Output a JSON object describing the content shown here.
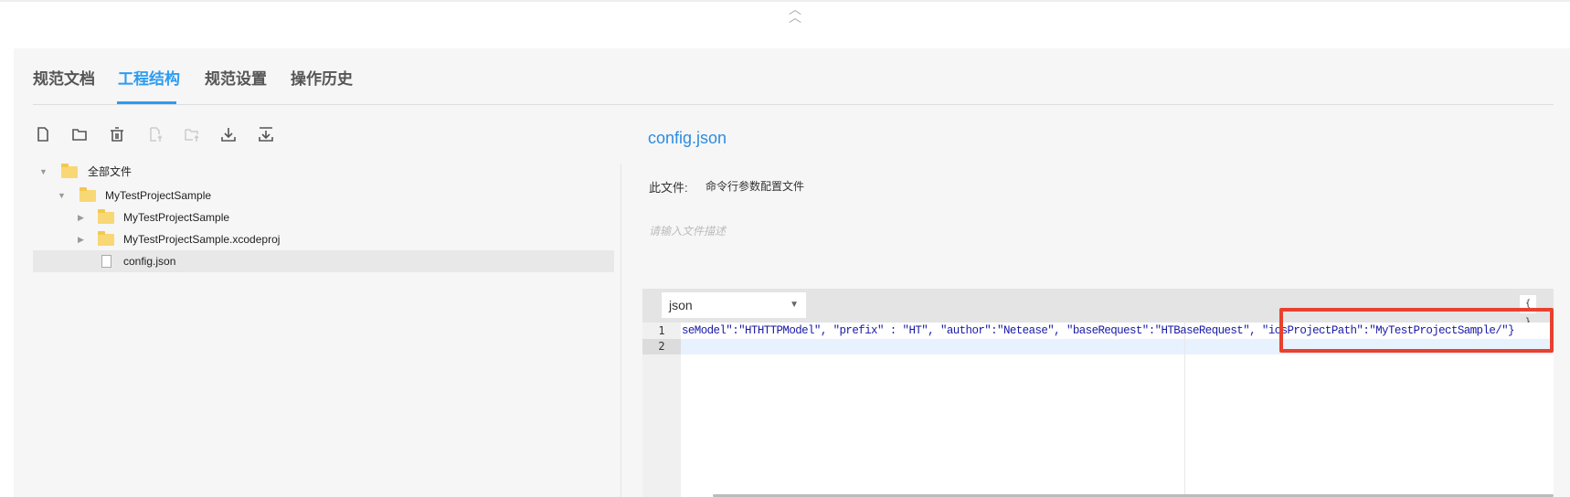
{
  "tabs": [
    {
      "label": "规范文档",
      "active": false
    },
    {
      "label": "工程结构",
      "active": true
    },
    {
      "label": "规范设置",
      "active": false
    },
    {
      "label": "操作历史",
      "active": false
    }
  ],
  "toolbar": [
    "new-file-icon",
    "new-folder-icon",
    "delete-icon",
    "upload-file-icon",
    "upload-folder-icon",
    "download-icon",
    "export-icon"
  ],
  "tree": [
    {
      "label": "全部文件",
      "type": "folder",
      "expanded": true
    },
    {
      "label": "MyTestProjectSample",
      "type": "folder",
      "expanded": true
    },
    {
      "label": "MyTestProjectSample",
      "type": "folder",
      "expanded": false
    },
    {
      "label": "MyTestProjectSample.xcodeproj",
      "type": "folder",
      "expanded": false
    },
    {
      "label": "config.json",
      "type": "file",
      "selected": true
    }
  ],
  "file": {
    "title": "config.json",
    "desc_label": "此文件:",
    "desc_value": "命令行参数配置文件",
    "desc_placeholder": "请输入文件描述"
  },
  "editor": {
    "language": "json",
    "format_label": "{ }",
    "line_numbers": [
      "1",
      "2"
    ],
    "line1": "seModel\":\"HTHTTPModel\", \"prefix\" : \"HT\", \"author\":\"Netease\", \"baseRequest\":\"HTBaseRequest\", \"iosProjectPath\":\"MyTestProjectSample/\"}",
    "line2": ""
  },
  "colors": {
    "accent": "#2d9cf0",
    "highlight_box": "#e8412e",
    "code_string": "#1a1aa6"
  }
}
